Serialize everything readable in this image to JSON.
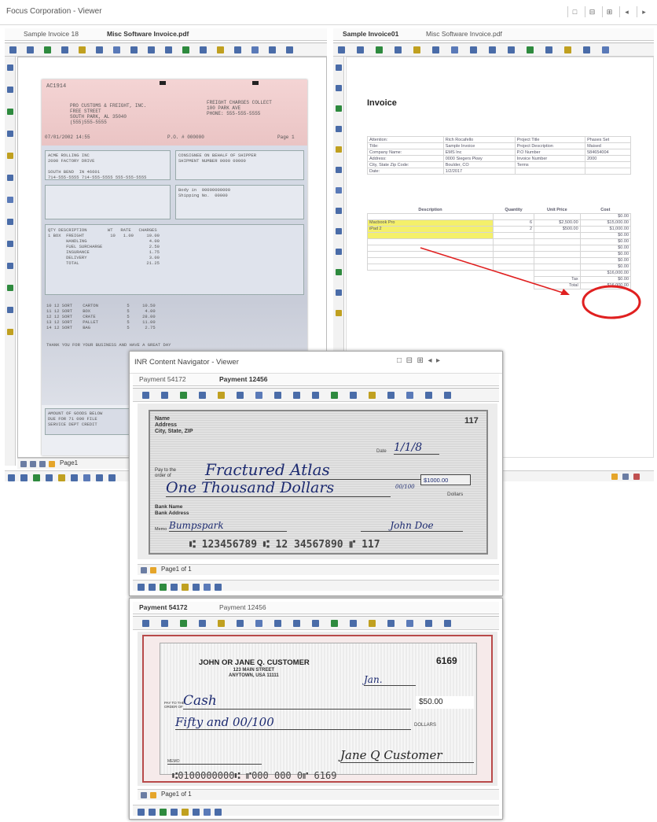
{
  "app": {
    "title": "Focus Corporation - Viewer",
    "window_buttons": [
      "□",
      "⊟",
      "⊞",
      "◂",
      "▸"
    ]
  },
  "left_pane": {
    "tabs": [
      {
        "label": "Sample Invoice 18",
        "active": false
      },
      {
        "label": "Misc Software Invoice.pdf",
        "active": true
      }
    ],
    "freight_bill": {
      "header_code": "AC1914",
      "company": "PRO CUSTOMS & FREIGHT, INC.\nFREE STREET\nSOUTH PARK, AL 35040\n(555)555-5555",
      "right_block": "FREIGHT CHARGES COLLECT\n100 PARK AVE\nPHONE: 555-555-5555",
      "ref_line": "07/01/2002 14:55",
      "pro": "P.O. # 000000",
      "page": "Page 1",
      "shipper": "ACME ROLLING INC\n2000 FACTORY DRIVE\n\nSOUTH BEND  IN 46601\n714-555-5555 714-555-5555 555-555-5555",
      "consignee": "CONSIGNEE ON BEHALF OF SHIPPER\nSHIPMENT NUMBER 0000 00000",
      "mid_right": "Body in  00000000000\nShipping No.  00000",
      "table_text": "QTY DESCRIPTION        WT   RATE   CHARGES\n1 BOX  FREIGHT          10   1.00     10.00\n       HANDLING                        4.00\n       FUEL SURCHARGE                  2.50\n       INSURANCE                       1.75\n       DELIVERY                        3.00\n       TOTAL                          21.25",
      "lower_text": "10 12 SORT    CARTON           5     10.50\n11 12 SORT    BOX              5      4.00\n12 12 SORT    CRATE            5     28.00\n13 12 SORT    PALLET           5     11.00\n14 12 SORT    BAG              5      2.75",
      "thanks": "THANK YOU FOR YOUR BUSINESS AND HAVE A GREAT DAY",
      "footer_box": "AMOUNT OF GOODS BELOW\nDUE FOR 71 000 FILE\nSERVICE DEPT CREDIT"
    },
    "page_field": "Page1"
  },
  "right_pane": {
    "tabs": [
      {
        "label": "Sample Invoice01",
        "active": true
      },
      {
        "label": "Misc Software Invoice.pdf",
        "active": false
      }
    ],
    "invoice": {
      "title": "Invoice",
      "info_rows": [
        [
          "Attention:",
          "Rich Rocafello",
          "Project Title",
          "Phases Set"
        ],
        [
          "Title:",
          "Sample Invoice",
          "Project Description",
          "Maised"
        ],
        [
          "Company Name:",
          "EMS Inc",
          "P.O Number",
          "584654004"
        ],
        [
          "Address:",
          "0000 Siegers Pkwy",
          "Invoice Number",
          "2000"
        ],
        [
          "City, State Zip Code:",
          "Boulder, CO",
          "Terms",
          ""
        ],
        [
          "Date:",
          "1/2/2017",
          "",
          ""
        ]
      ],
      "item_headers": [
        "Description",
        "Quantity",
        "Unit Price",
        "Cost"
      ],
      "items": [
        [
          "",
          "",
          "",
          "$0.00"
        ],
        [
          "Macbook Pro",
          "6",
          "$2,500.00",
          "$15,000.00"
        ],
        [
          "iPad 2",
          "2",
          "$500.00",
          "$1,000.00"
        ],
        [
          "",
          "",
          "",
          "$0.00"
        ],
        [
          "",
          "",
          "",
          "$0.00"
        ],
        [
          "",
          "",
          "",
          "$0.00"
        ],
        [
          "",
          "",
          "",
          "$0.00"
        ],
        [
          "",
          "",
          "",
          "$0.00"
        ],
        [
          "",
          "",
          "",
          "$0.00"
        ]
      ],
      "subtotal": "$16,000.00",
      "tax_label": "Tax",
      "tax": "$0.00",
      "total_label": "Total",
      "total": "$16,000.00"
    }
  },
  "check_viewer_1": {
    "title": "INR Content Navigator - Viewer",
    "tabs": [
      {
        "label": "Payment 54172",
        "active": false
      },
      {
        "label": "Payment 12456",
        "active": true
      }
    ],
    "check": {
      "name_block": "Name\nAddress\nCity, State, ZIP",
      "number": "117",
      "date_label": "Date",
      "date": "1/1/8",
      "pay_to_label": "Pay to the\norder of",
      "payee": "Fractured Atlas",
      "amount_box": "$1000.00",
      "amount_words": "One Thousand Dollars",
      "fraction": "00/100",
      "dollars_label": "Dollars",
      "bank": "Bank Name\nBank Address",
      "memo_label": "Memo",
      "memo": "Bumpspark",
      "signature": "John Doe",
      "micr": "⑆ 123456789 ⑆  12 34567890 ⑈ 117"
    },
    "page_field": "Page1 of 1"
  },
  "check_viewer_2": {
    "tabs": [
      {
        "label": "Payment 54172",
        "active": true
      },
      {
        "label": "Payment 12456",
        "active": false
      }
    ],
    "check": {
      "payer": "JOHN OR JANE Q. CUSTOMER",
      "address": "123 MAIN STREET\nANYTOWN, USA 11111",
      "number": "6169",
      "date": "Jan.",
      "pay_label": "PAY TO THE\nORDER OF",
      "payee": "Cash",
      "amount": "$50.00",
      "words": "Fifty and 00/100",
      "dollars": "DOLLARS",
      "memo_label": "MEMO",
      "signature": "Jane Q Customer",
      "micr": "⑆0100000000⑆ ⑈000 000 0⑈ 6169"
    },
    "page_field": "Page1 of 1"
  },
  "colors": {
    "accent_red": "#e02020",
    "highlight": "#f4f06a",
    "toolbar_icon": "#4a6ca8"
  }
}
